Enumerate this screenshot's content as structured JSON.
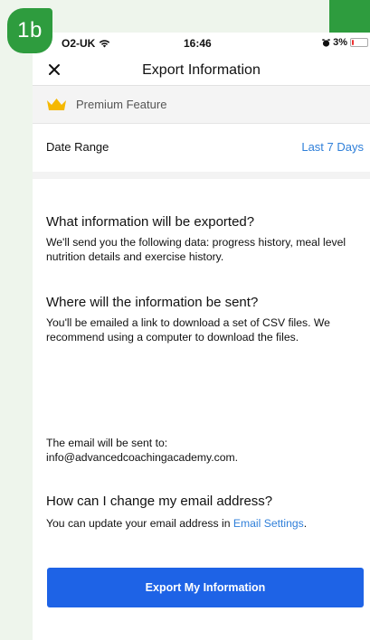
{
  "step_badge": "1b",
  "status_bar": {
    "carrier": "O2-UK",
    "time": "16:46",
    "battery": "3%"
  },
  "nav": {
    "title": "Export Information"
  },
  "premium": {
    "label": "Premium Feature"
  },
  "date_range": {
    "label": "Date Range",
    "value": "Last 7 Days"
  },
  "what": {
    "heading": "What information will be exported?",
    "body": "We'll send you the following data: progress history, meal level nutrition details and exercise history."
  },
  "where": {
    "heading": "Where will the information be sent?",
    "body": "You'll be emailed a link to download a set of CSV files. We recommend using a computer to download the files."
  },
  "email_notice": {
    "line1": "The email will be sent to:",
    "address": "info@advancedcoachingacademy.com."
  },
  "change": {
    "heading": "How can I change my email address?",
    "body_prefix": "You can update your email address in ",
    "link": "Email Settings",
    "body_suffix": "."
  },
  "export_button": {
    "label": "Export My Information"
  },
  "colors": {
    "accent": "#2f7fd9",
    "button": "#1e63e6",
    "badge": "#2e9c3e",
    "crown": "#f5b800",
    "battery_low": "#e33333"
  }
}
